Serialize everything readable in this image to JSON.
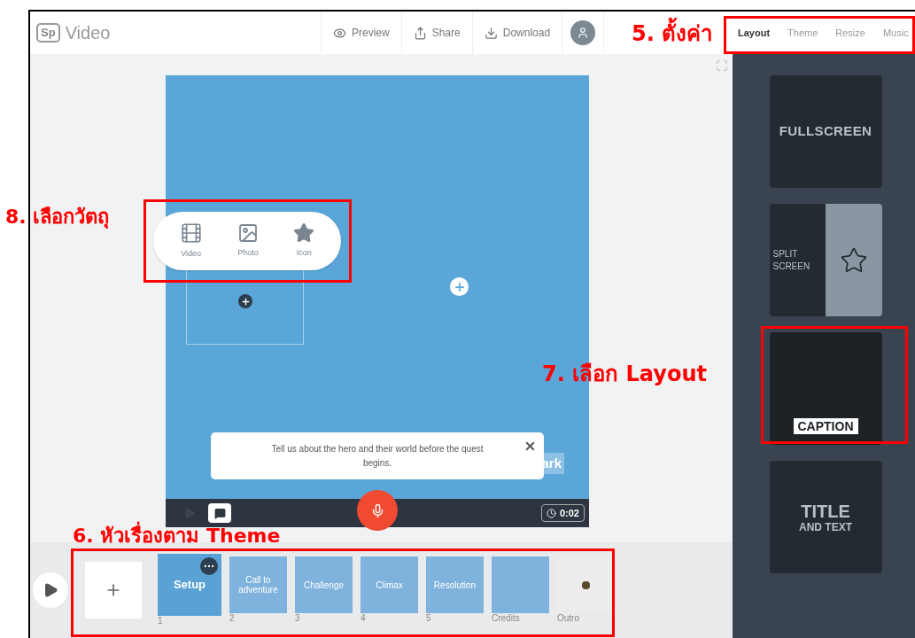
{
  "app": {
    "logo": "Sp",
    "title": "Video"
  },
  "header_actions": [
    {
      "label": "Preview",
      "kind": "preview"
    },
    {
      "label": "Share",
      "kind": "share"
    },
    {
      "label": "Download",
      "kind": "download"
    }
  ],
  "tabs": [
    {
      "label": "Layout",
      "selected": true
    },
    {
      "label": "Theme",
      "selected": false
    },
    {
      "label": "Resize",
      "selected": false
    },
    {
      "label": "Music",
      "selected": false
    }
  ],
  "insert_menu": [
    {
      "label": "Video",
      "kind": "video"
    },
    {
      "label": "Photo",
      "kind": "photo"
    },
    {
      "label": "Icon",
      "kind": "icon"
    }
  ],
  "prompt": "Tell us about the hero and their world before the quest begins.",
  "watermark": "ark",
  "timer": "0:02",
  "slides": [
    {
      "title": "Setup",
      "number": "1",
      "selected": true,
      "kind": "story"
    },
    {
      "title": "Call to adventure",
      "number": "2",
      "selected": false,
      "kind": "story"
    },
    {
      "title": "Challenge",
      "number": "3",
      "selected": false,
      "kind": "story"
    },
    {
      "title": "Climax",
      "number": "4",
      "selected": false,
      "kind": "story"
    },
    {
      "title": "Resolution",
      "number": "5",
      "selected": false,
      "kind": "story"
    },
    {
      "number": "Credits",
      "selected": false,
      "kind": "story"
    },
    {
      "number": "Outro",
      "selected": false,
      "kind": "outro"
    }
  ],
  "layouts": [
    {
      "kind": "fullscreen",
      "label": "FULLSCREEN"
    },
    {
      "kind": "split",
      "label": "SPLIT SCREEN"
    },
    {
      "kind": "caption",
      "label": "CAPTION"
    },
    {
      "kind": "title",
      "label": "TITLE",
      "sublabel": "AND TEXT"
    }
  ],
  "annotations": [
    {
      "text": "5. ตั้งค่า"
    },
    {
      "text": "8. เลือกวัตถุ"
    },
    {
      "text": "7. เลือก Layout"
    },
    {
      "text": "6. หัวเรื่องตาม Theme"
    }
  ]
}
